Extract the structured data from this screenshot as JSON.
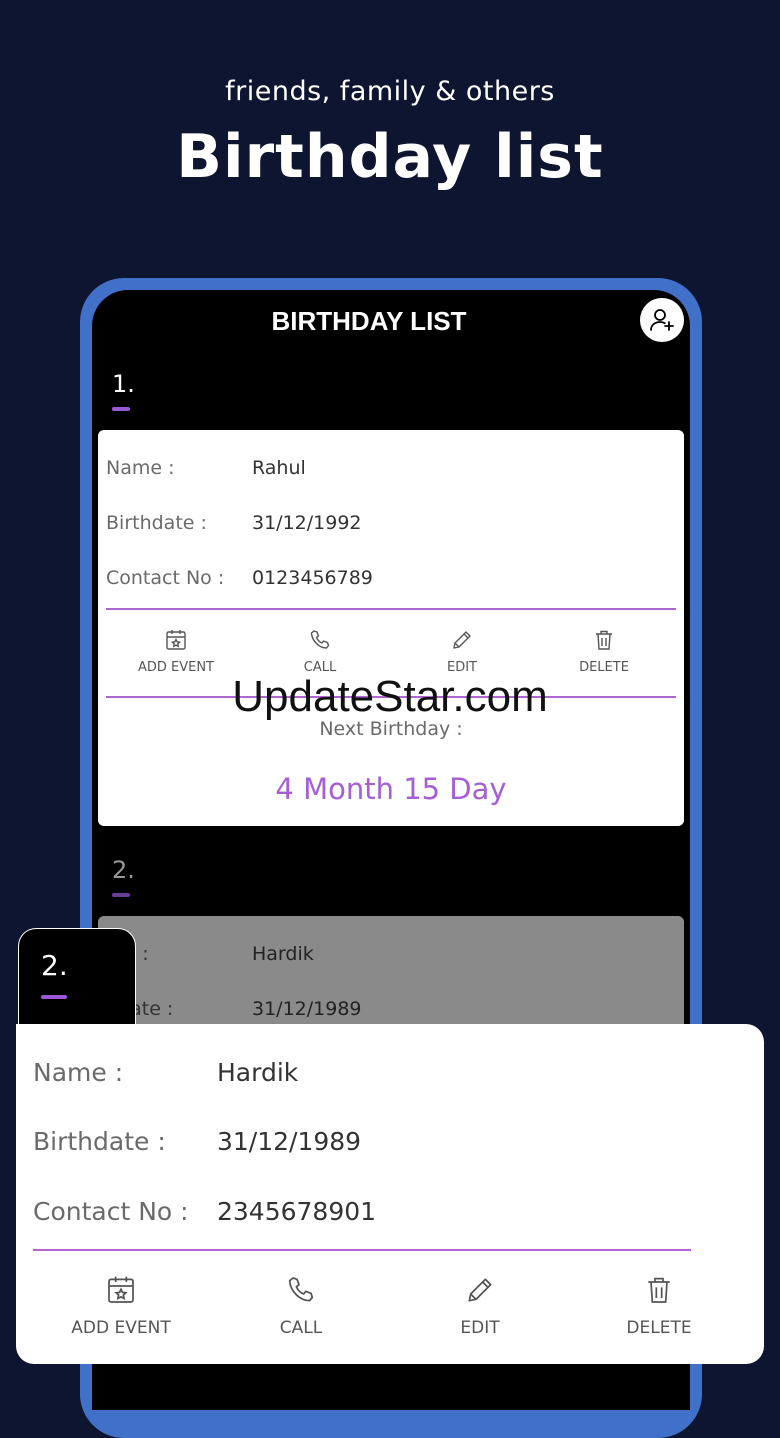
{
  "header": {
    "subtitle": "friends, family & others",
    "title": "Birthday list"
  },
  "app": {
    "title": "BIRTHDAY LIST",
    "add_user_icon": "add-user-icon"
  },
  "labels": {
    "name": "Name :",
    "birthdate": "Birthdate :",
    "contact": "Contact No :",
    "next_birthday": "Next Birthday :",
    "name_partial": "me :",
    "birthdate_partial": "hdate :"
  },
  "actions": {
    "add_event": "ADD EVENT",
    "call": "CALL",
    "edit": "EDIT",
    "delete": "DELETE"
  },
  "entries": [
    {
      "index": "1.",
      "name": "Rahul",
      "birthdate": "31/12/1992",
      "contact": "0123456789",
      "next_birthday": "4 Month 15 Day"
    },
    {
      "index": "2.",
      "name": "Hardik",
      "birthdate": "31/12/1989",
      "contact": "2345678901"
    }
  ],
  "watermark": "UpdateStar.com",
  "colors": {
    "background": "#0e1530",
    "phone_frame": "#4070c8",
    "accent": "#a45ed8"
  }
}
